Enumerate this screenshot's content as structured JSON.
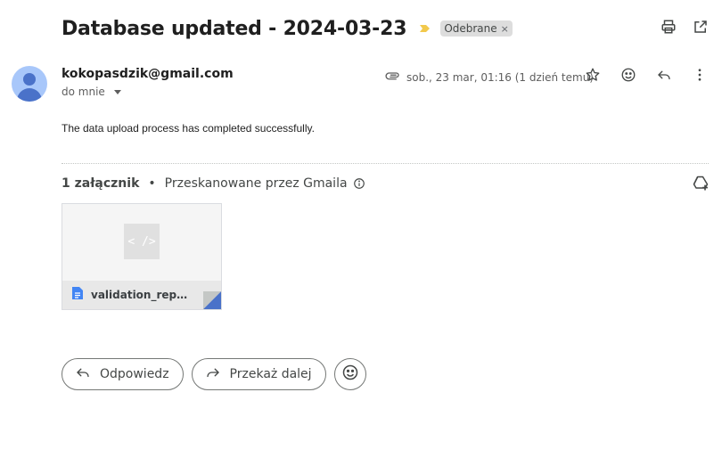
{
  "email": {
    "subject": "Database updated - 2024-03-23",
    "label": "Odebrane",
    "label_remove": "×",
    "sender": "kokopasdzik@gmail.com",
    "to": "do mnie",
    "date": "sob., 23 mar, 01:16 (1 dzień temu)",
    "body": "The data upload process has completed successfully."
  },
  "attachments": {
    "count_label": "1 załącznik",
    "separator": "•",
    "scan_label": "Przeskanowane przez Gmaila",
    "items": [
      {
        "name": "validation_report...",
        "thumb_glyph": "< />"
      }
    ]
  },
  "actions": {
    "reply": "Odpowiedz",
    "forward": "Przekaż dalej"
  },
  "icons": {
    "importance": "importance-marker-icon",
    "print": "print-icon",
    "new_window": "open-in-new-window-icon",
    "attachment": "paperclip-icon",
    "star": "star-icon",
    "emoji": "emoji-icon",
    "reply": "reply-icon",
    "more": "more-vert-icon",
    "info": "info-icon",
    "drive": "add-to-drive-icon",
    "doc": "document-icon"
  },
  "colors": {
    "importance": "#f2c94c",
    "avatar_bg": "#a8c7fa",
    "avatar_fg": "#4a72c9",
    "doc_icon": "#4285f4",
    "chip_bg": "#dddddd"
  }
}
